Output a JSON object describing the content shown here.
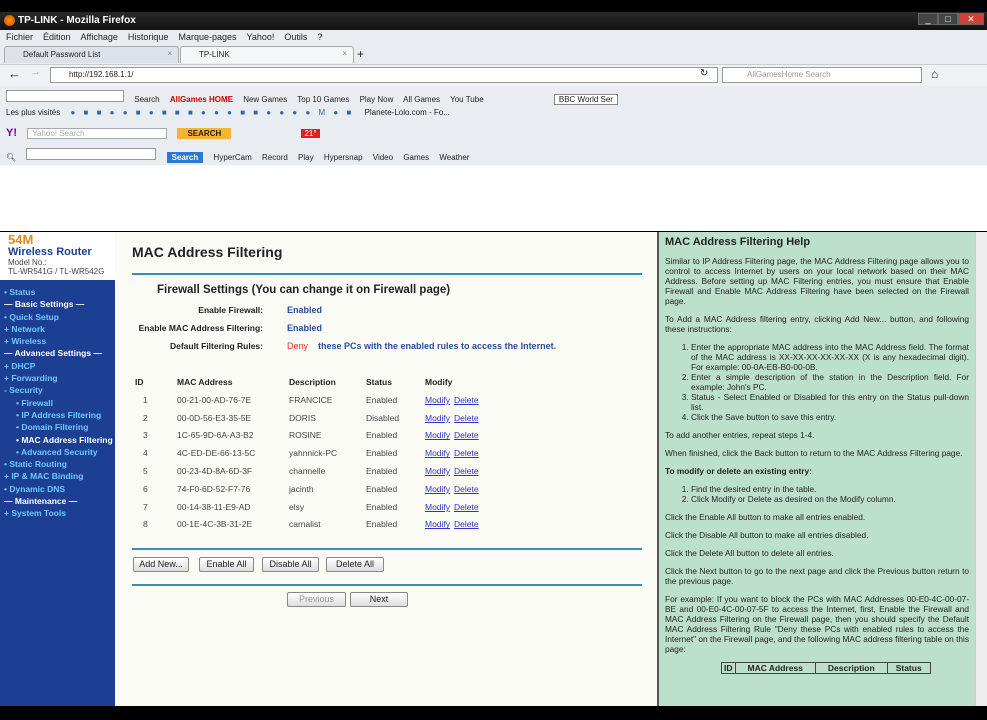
{
  "window": {
    "title": "TP-LINK - Mozilla Firefox"
  },
  "menubar": [
    "Fichier",
    "Édition",
    "Affichage",
    "Historique",
    "Marque-pages",
    "Yahoo!",
    "Outils",
    "?"
  ],
  "tabs": [
    {
      "label": "Default Password List"
    },
    {
      "label": "TP-LINK"
    }
  ],
  "nav": {
    "url": "http://192.168.1.1/",
    "search_placeholder": "AllGamesHome Search"
  },
  "toolbar1": {
    "search": "Search",
    "brand": "AllGames HOME",
    "items": [
      "New Games",
      "Top 10 Games",
      "Play Now",
      "All Games",
      "You Tube"
    ],
    "radio": "BBC World Ser"
  },
  "bookmarks": {
    "first": "Les plus visités",
    "last": "Planete-Lolo.com - Fo..."
  },
  "yahoo": {
    "placeholder": "Yahoo! Search",
    "search_btn": "SEARCH",
    "temp": "21°"
  },
  "toolbar3": {
    "search_btn": "Search",
    "items": [
      "HyperCam",
      "Record",
      "Play",
      "Hypersnap",
      "Video",
      "Games",
      "Weather"
    ]
  },
  "sidebar": {
    "brand": "54M",
    "product": "Wireless  Router",
    "model_label": "Model No.:",
    "model": "TL-WR541G / TL-WR542G",
    "items": [
      {
        "label": "• Status",
        "type": "item"
      },
      {
        "label": "— Basic Settings —",
        "type": "sec"
      },
      {
        "label": "• Quick Setup",
        "type": "item"
      },
      {
        "label": "+ Network",
        "type": "item"
      },
      {
        "label": "+ Wireless",
        "type": "item"
      },
      {
        "label": "— Advanced Settings —",
        "type": "sec"
      },
      {
        "label": "+ DHCP",
        "type": "item"
      },
      {
        "label": "+ Forwarding",
        "type": "item"
      },
      {
        "label": "- Security",
        "type": "item"
      },
      {
        "label": "• Firewall",
        "type": "sub"
      },
      {
        "label": "• IP Address Filtering",
        "type": "sub"
      },
      {
        "label": "• Domain Filtering",
        "type": "sub"
      },
      {
        "label": "• MAC Address Filtering",
        "type": "sub cur"
      },
      {
        "label": "• Advanced Security",
        "type": "sub"
      },
      {
        "label": "• Static Routing",
        "type": "item"
      },
      {
        "label": "+ IP & MAC Binding",
        "type": "item"
      },
      {
        "label": "• Dynamic DNS",
        "type": "item"
      },
      {
        "label": "— Maintenance —",
        "type": "sec"
      },
      {
        "label": "+ System Tools",
        "type": "item"
      }
    ]
  },
  "main": {
    "title": "MAC Address Filtering",
    "firewall_heading": "Firewall Settings (You can change it on Firewall page)",
    "enable_firewall_label": "Enable Firewall:",
    "enable_firewall": "Enabled",
    "enable_mac_label": "Enable MAC Address Filtering:",
    "enable_mac": "Enabled",
    "rules_label": "Default Filtering Rules:",
    "rule": "Deny",
    "rule_text": "these PCs with the enabled rules to access the Internet.",
    "columns": [
      "ID",
      "MAC Address",
      "Description",
      "Status",
      "Modify"
    ],
    "rows": [
      [
        "1",
        "00-21-00-AD-76-7E",
        "FRANCICE",
        "Enabled"
      ],
      [
        "2",
        "00-0D-56-E3-35-5E",
        "DORIS",
        "Disabled"
      ],
      [
        "3",
        "1C-65-9D-6A-A3-B2",
        "ROSINE",
        "Enabled"
      ],
      [
        "4",
        "4C-ED-DE-66-13-5C",
        "yahnnick-PC",
        "Enabled"
      ],
      [
        "5",
        "00-23-4D-8A-6D-3F",
        "channelle",
        "Enabled"
      ],
      [
        "6",
        "74-F0-6D-52-F7-76",
        "jacinth",
        "Enabled"
      ],
      [
        "7",
        "00-14-38-11-E9-AD",
        "elsy",
        "Enabled"
      ],
      [
        "8",
        "00-1E-4C-3B-31-2E",
        "carnalist",
        "Enabled"
      ]
    ],
    "modify_link": "Modify",
    "delete_link": "Delete",
    "buttons": {
      "add": "Add New...",
      "enable_all": "Enable All",
      "disable_all": "Disable All",
      "delete_all": "Delete All",
      "previous": "Previous",
      "next": "Next"
    }
  },
  "help": {
    "title": "MAC Address Filtering Help",
    "p1": "Similar to IP Address Filtering page, the MAC Address Filtering page allows you to control to access Internet by users on your local network based on their MAC Address. Before setting up MAC Filtering entries, you must ensure that Enable Firewall and Enable MAC Address Filtering have been selected on the Firewall page.",
    "p2": "To Add a MAC Address filtering entry, clicking Add New... button, and following these instructions:",
    "steps": [
      "Enter the appropriate MAC address into the MAC Address field. The format of the MAC address is XX-XX-XX-XX-XX-XX (X is any hexadecimal digit). For example: 00-0A-EB-B0-00-0B.",
      "Enter a simple description of the station in the Description field. For example: John's PC.",
      "Status - Select Enabled or Disabled for this entry on the Status pull-down list.",
      "Click the Save button to save this entry."
    ],
    "p3": "To add another entries, repeat steps 1-4.",
    "p4": "When finished, click the Back button to return to the MAC Address Filtering page.",
    "p5": "To modify or delete an existing entry:",
    "steps2": [
      "Find the desired entry in the table.",
      "Click Modify or Delete as desired on the Modify column."
    ],
    "p6": "Click the Enable All button to make all entries enabled.",
    "p7": "Click the Disable All button to make all entries disabled.",
    "p8": "Click the Delete All button to delete all entries.",
    "p9": "Click the Next button to go to the next page and click the Previous button return to the previous page.",
    "p10": "For example: If you want to block the PCs with MAC Addresses 00-E0-4C-00-07-BE and 00-E0-4C-00-07-5F to access the Internet, first, Enable the Firewall and MAC Address Filtering on the Firewall page, then you should specify the Default MAC Address Filtering Rule \"Deny these PCs with enabled rules to access the Internet\" on the Firewall page, and the following MAC address filtering table on this page:",
    "example_cols": [
      "ID",
      "MAC Address",
      "Description",
      "Status"
    ]
  }
}
